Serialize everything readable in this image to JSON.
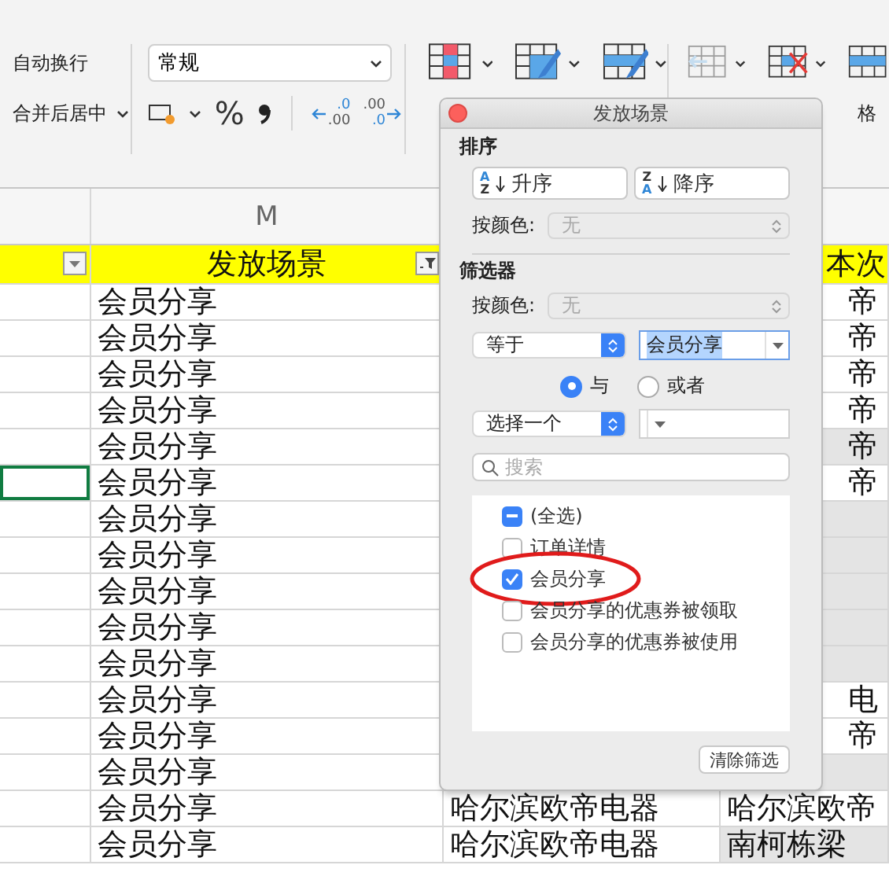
{
  "ribbon": {
    "wrap_text": "自动换行",
    "merge_center": "合并后居中",
    "number_format": "常规",
    "percent": "%",
    "decimal_buttons": [
      {
        "kind": "decrease",
        "upper": ".0",
        "lower": ".00"
      },
      {
        "kind": "increase",
        "upper": ".00",
        "lower": ".0"
      }
    ],
    "format_label": "格"
  },
  "sheet": {
    "column_letter": "M",
    "header_m": "发放场景",
    "header_o": "本次",
    "filters": [
      {
        "active": false
      },
      {
        "active": true
      }
    ],
    "rows": [
      {
        "m": "会员分享",
        "o": "帝",
        "o_shaded": false,
        "dialog_over": true,
        "cell_selected": false
      },
      {
        "m": "会员分享",
        "o": "帝",
        "o_shaded": false,
        "dialog_over": true,
        "cell_selected": false
      },
      {
        "m": "会员分享",
        "o": "帝",
        "o_shaded": false,
        "dialog_over": true,
        "cell_selected": false
      },
      {
        "m": "会员分享",
        "o": "帝",
        "o_shaded": false,
        "dialog_over": true,
        "cell_selected": false
      },
      {
        "m": "会员分享",
        "o": "帝",
        "o_shaded": true,
        "dialog_over": true,
        "cell_selected": false
      },
      {
        "m": "会员分享",
        "o": "帝",
        "o_shaded": false,
        "dialog_over": true,
        "cell_selected": true
      },
      {
        "m": "会员分享",
        "o_shaded": true,
        "dialog_over": true,
        "cell_selected": false
      },
      {
        "m": "会员分享",
        "o_shaded": true,
        "dialog_over": true,
        "cell_selected": false
      },
      {
        "m": "会员分享",
        "o_shaded": true,
        "dialog_over": true,
        "cell_selected": false
      },
      {
        "m": "会员分享",
        "o_shaded": true,
        "dialog_over": true,
        "cell_selected": false
      },
      {
        "m": "会员分享",
        "o_shaded": true,
        "dialog_over": true,
        "cell_selected": false
      },
      {
        "m": "会员分享",
        "o": "电",
        "o_shaded": false,
        "dialog_over": true,
        "cell_selected": false
      },
      {
        "m": "会员分享",
        "o": "帝",
        "o_shaded": false,
        "dialog_over": true,
        "cell_selected": false
      },
      {
        "m": "会员分享",
        "o_shaded": true,
        "dialog_over": true,
        "cell_selected": false
      },
      {
        "m": "会员分享",
        "n": "哈尔滨欧帝电器",
        "o": "哈尔滨欧帝",
        "o_shaded": false,
        "dialog_over": false,
        "cell_selected": false
      },
      {
        "m": "会员分享",
        "n": "哈尔滨欧帝电器",
        "o": "南柯栋梁",
        "o_shaded": true,
        "dialog_over": false,
        "cell_selected": false
      }
    ]
  },
  "dialog": {
    "title": "发放场景",
    "sort_heading": "排序",
    "sort_buttons": [
      {
        "kind": "ascending",
        "label": "升序",
        "top": "A",
        "bottom": "Z"
      },
      {
        "kind": "descending",
        "label": "降序",
        "top": "Z",
        "bottom": "A"
      }
    ],
    "sort_color": {
      "label": "按颜色:",
      "value": "无",
      "disabled": true
    },
    "filter_heading": "筛选器",
    "filter_color": {
      "label": "按颜色:",
      "value": "无",
      "disabled": true
    },
    "condition_1": {
      "operator": "等于",
      "value": "会员分享",
      "value_selected": true
    },
    "joins": [
      {
        "label": "与",
        "selected": true
      },
      {
        "label": "或者",
        "selected": false
      }
    ],
    "condition_2": {
      "operator": "选择一个"
    },
    "search": {
      "placeholder": "搜索"
    },
    "items": [
      {
        "label": "(全选)",
        "checked": true,
        "mixed": true,
        "circled": false
      },
      {
        "label": "订单详情",
        "checked": false,
        "mixed": false,
        "circled": false
      },
      {
        "label": "会员分享",
        "checked": true,
        "mixed": false,
        "circled": true
      },
      {
        "label": "会员分享的优惠券被领取",
        "checked": false,
        "mixed": false,
        "circled": false
      },
      {
        "label": "会员分享的优惠券被使用",
        "checked": false,
        "mixed": false,
        "circled": false
      }
    ],
    "clear_button": "清除筛选"
  }
}
